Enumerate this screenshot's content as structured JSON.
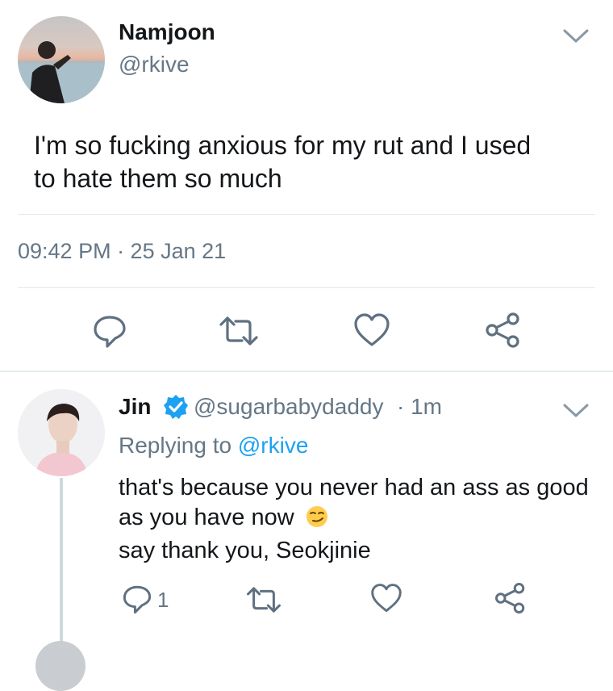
{
  "main_tweet": {
    "author_name": "Namjoon",
    "handle": "@rkive",
    "text_line1": "I'm so fucking anxious for my rut and I used",
    "text_line2": "to hate them so much",
    "timestamp": "09:42 PM · 25 Jan 21"
  },
  "reply": {
    "author_name": "Jin",
    "handle": "@sugarbabydaddy",
    "time": "· 1m",
    "replying_prefix": "Replying to",
    "replying_handle": "@rkive",
    "text_line1": "that's because you never had an ass as good",
    "text_line2": "as you have now",
    "text_line3": "say thank you, Seokjinie",
    "reply_count": "1"
  },
  "colors": {
    "accent": "#1da1f2",
    "muted": "#657786",
    "icon_gray": "#5f7081"
  },
  "icons": [
    "chevron-down-icon",
    "reply-icon",
    "retweet-icon",
    "like-icon",
    "share-icon",
    "verified-icon",
    "smirk-emoji-icon"
  ]
}
